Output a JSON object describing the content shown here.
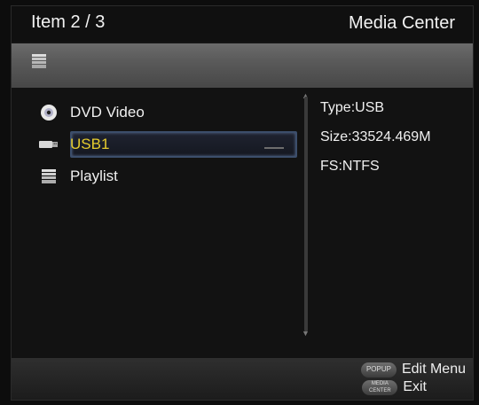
{
  "header": {
    "item_counter": "Item 2 / 3",
    "title": "Media Center"
  },
  "path_bar": {
    "icon": "folder-icon"
  },
  "list": {
    "items": [
      {
        "label": "DVD Video",
        "icon": "disc-icon",
        "selected": false
      },
      {
        "label": "USB1",
        "icon": "usb-icon",
        "selected": true
      },
      {
        "label": "Playlist",
        "icon": "folder-icon",
        "selected": false
      }
    ]
  },
  "info": {
    "type": "Type:USB",
    "size": "Size:33524.469M",
    "fs": "FS:NTFS"
  },
  "footer": {
    "popup_key": "POPUP",
    "popup_action": "Edit Menu",
    "media_key_line1": "MEDIA",
    "media_key_line2": "CENTER",
    "media_action": "Exit"
  },
  "colors": {
    "selected_text": "#e6cc2e",
    "selection_border": "#3c4e6b",
    "background": "#141414"
  }
}
